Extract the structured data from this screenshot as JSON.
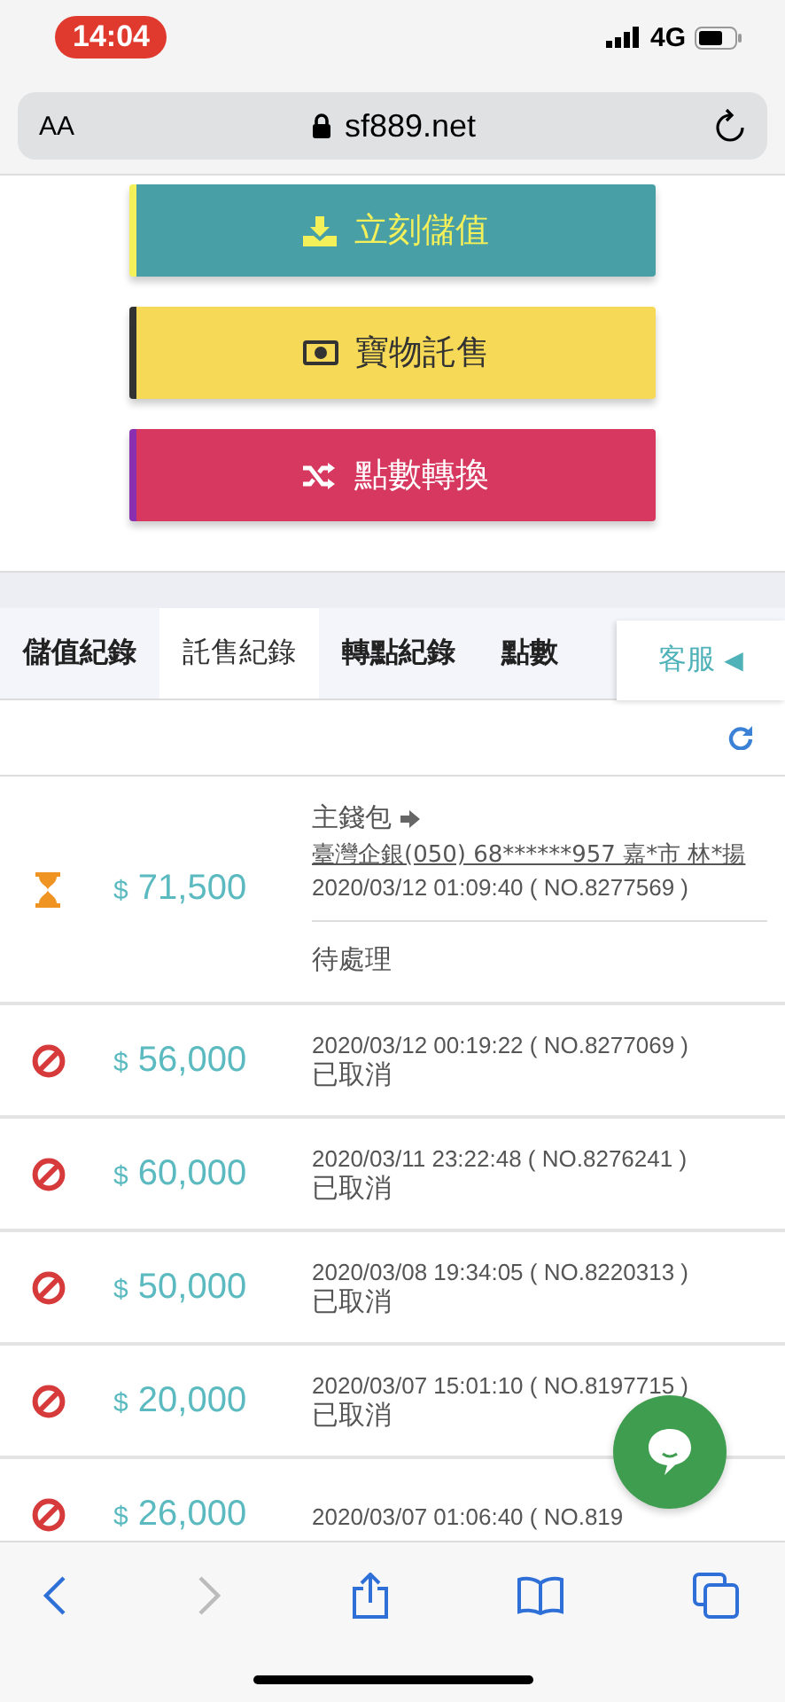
{
  "status_bar": {
    "time": "14:04",
    "network": "4G"
  },
  "address_bar": {
    "text_size": "AA",
    "url": "sf889.net"
  },
  "actions": [
    {
      "label": "立刻儲值",
      "kind": "deposit"
    },
    {
      "label": "寶物託售",
      "kind": "consign"
    },
    {
      "label": "點數轉換",
      "kind": "transfer"
    }
  ],
  "tabs": [
    {
      "label": "儲值紀錄",
      "selected": false
    },
    {
      "label": "託售紀錄",
      "selected": true
    },
    {
      "label": "轉點紀錄",
      "selected": false
    },
    {
      "label": "點數",
      "selected": false
    }
  ],
  "support_button": {
    "label": "客服",
    "arrow": "◀"
  },
  "records": [
    {
      "kind": "pending",
      "currency": "$",
      "amount": "71,500",
      "wallet": "主錢包",
      "bank": "臺灣企銀(050) 68******957 嘉*市 林*揚",
      "timestamp": "2020/03/12 01:09:40 ( NO.8277569 )",
      "status_text": "待處理"
    },
    {
      "kind": "cancelled",
      "currency": "$",
      "amount": "56,000",
      "timestamp": "2020/03/12 00:19:22 ( NO.8277069 )",
      "status_text": "已取消"
    },
    {
      "kind": "cancelled",
      "currency": "$",
      "amount": "60,000",
      "timestamp": "2020/03/11 23:22:48 ( NO.8276241 )",
      "status_text": "已取消"
    },
    {
      "kind": "cancelled",
      "currency": "$",
      "amount": "50,000",
      "timestamp": "2020/03/08 19:34:05 ( NO.8220313 )",
      "status_text": "已取消"
    },
    {
      "kind": "cancelled",
      "currency": "$",
      "amount": "20,000",
      "timestamp": "2020/03/07 15:01:10 ( NO.8197715 )",
      "status_text": "已取消"
    },
    {
      "kind": "cancelled",
      "currency": "$",
      "amount": "26,000",
      "timestamp": "2020/03/07 01:06:40 ( NO.819"
    }
  ],
  "nav": {
    "back_disabled": false,
    "forward_disabled": true
  }
}
